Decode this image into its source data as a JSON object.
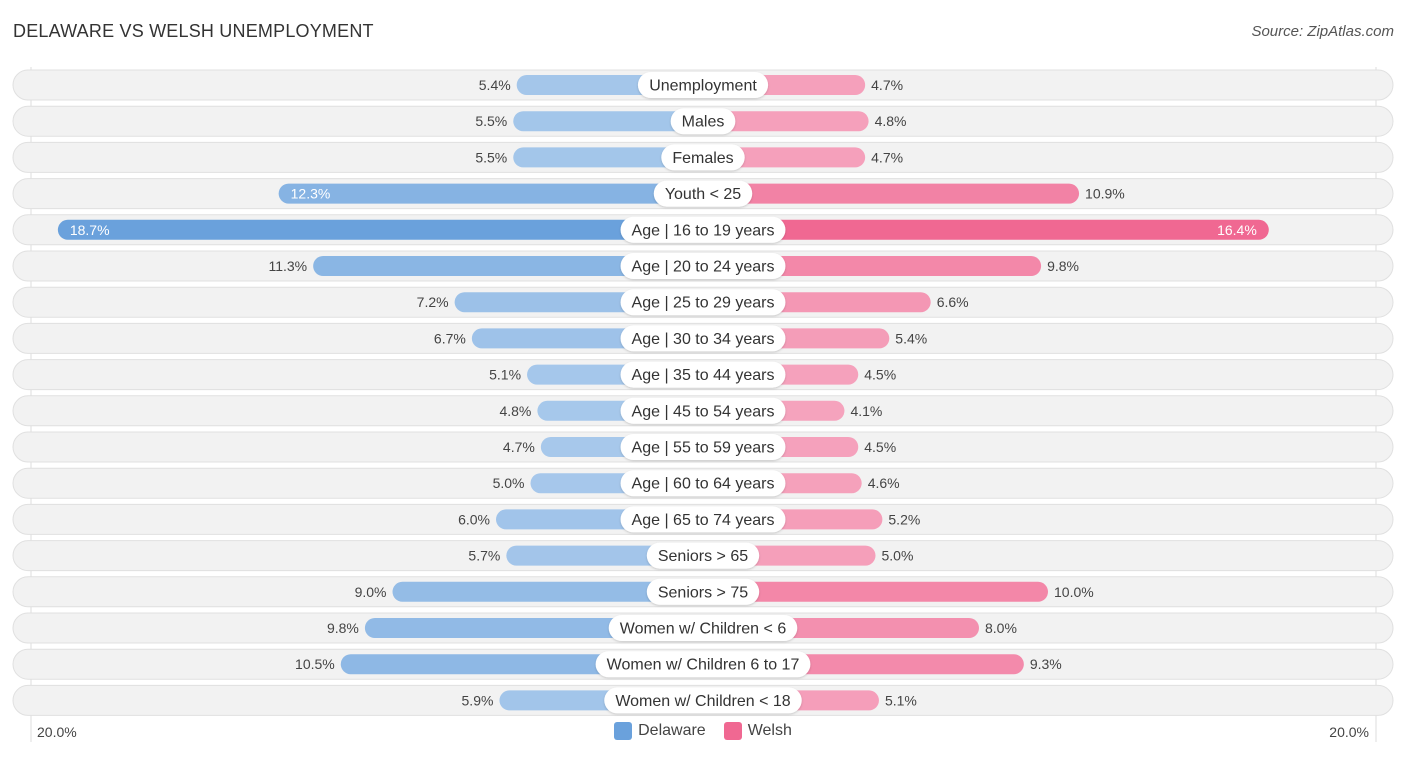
{
  "header": {
    "title": "DELAWARE VS WELSH UNEMPLOYMENT",
    "source": "Source: ZipAtlas.com"
  },
  "colors": {
    "delaware": "#6aa1dc",
    "delaware_light": "#a7c8eb",
    "welsh": "#f06892",
    "welsh_light": "#f5a3bd",
    "row_bg": "#f2f2f2"
  },
  "axis": {
    "left_label": "20.0%",
    "right_label": "20.0%"
  },
  "legend": {
    "items": [
      {
        "label": "Delaware",
        "color": "#6aa1dc"
      },
      {
        "label": "Welsh",
        "color": "#f06892"
      }
    ]
  },
  "chart_data": {
    "type": "bar",
    "orientation": "horizontal-diverging",
    "title": "DELAWARE VS WELSH UNEMPLOYMENT",
    "xlabel": "",
    "ylabel": "",
    "xlim": [
      -20,
      20
    ],
    "legend_position": "bottom-center",
    "categories": [
      "Unemployment",
      "Males",
      "Females",
      "Youth < 25",
      "Age | 16 to 19 years",
      "Age | 20 to 24 years",
      "Age | 25 to 29 years",
      "Age | 30 to 34 years",
      "Age | 35 to 44 years",
      "Age | 45 to 54 years",
      "Age | 55 to 59 years",
      "Age | 60 to 64 years",
      "Age | 65 to 74 years",
      "Seniors > 65",
      "Seniors > 75",
      "Women w/ Children < 6",
      "Women w/ Children 6 to 17",
      "Women w/ Children < 18"
    ],
    "series": [
      {
        "name": "Delaware",
        "side": "left",
        "values": [
          5.4,
          5.5,
          5.5,
          12.3,
          18.7,
          11.3,
          7.2,
          6.7,
          5.1,
          4.8,
          4.7,
          5.0,
          6.0,
          5.7,
          9.0,
          9.8,
          10.5,
          5.9
        ],
        "labels": [
          "5.4%",
          "5.5%",
          "5.5%",
          "12.3%",
          "18.7%",
          "11.3%",
          "7.2%",
          "6.7%",
          "5.1%",
          "4.8%",
          "4.7%",
          "5.0%",
          "6.0%",
          "5.7%",
          "9.0%",
          "9.8%",
          "10.5%",
          "5.9%"
        ]
      },
      {
        "name": "Welsh",
        "side": "right",
        "values": [
          4.7,
          4.8,
          4.7,
          10.9,
          16.4,
          9.8,
          6.6,
          5.4,
          4.5,
          4.1,
          4.5,
          4.6,
          5.2,
          5.0,
          10.0,
          8.0,
          9.3,
          5.1
        ],
        "labels": [
          "4.7%",
          "4.8%",
          "4.7%",
          "10.9%",
          "16.4%",
          "9.8%",
          "6.6%",
          "5.4%",
          "4.5%",
          "4.1%",
          "4.5%",
          "4.6%",
          "5.2%",
          "5.0%",
          "10.0%",
          "8.0%",
          "9.3%",
          "5.1%"
        ]
      }
    ]
  }
}
